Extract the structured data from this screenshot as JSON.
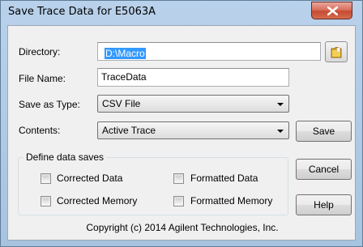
{
  "window": {
    "title": "Save Trace Data for E5063A",
    "close_icon": "close-icon"
  },
  "form": {
    "directory_label": "Directory:",
    "directory_value": "D:\\Macro",
    "file_name_label": "File Name:",
    "file_name_value": "TraceData",
    "save_as_type_label": "Save as Type:",
    "save_as_type_value": "CSV File",
    "contents_label": "Contents:",
    "contents_value": "Active Trace",
    "browse_icon": "folder-icon"
  },
  "group": {
    "title": "Define data saves",
    "options": {
      "corrected_data": {
        "label": "Corrected Data",
        "checked": false
      },
      "formatted_data": {
        "label": "Formatted Data",
        "checked": false
      },
      "corrected_memory": {
        "label": "Corrected Memory",
        "checked": false
      },
      "formatted_memory": {
        "label": "Formatted Memory",
        "checked": false
      }
    }
  },
  "buttons": {
    "save": "Save",
    "cancel": "Cancel",
    "help": "Help"
  },
  "footer": {
    "copyright": "Copyright (c) 2014 Agilent Technologies, Inc."
  }
}
